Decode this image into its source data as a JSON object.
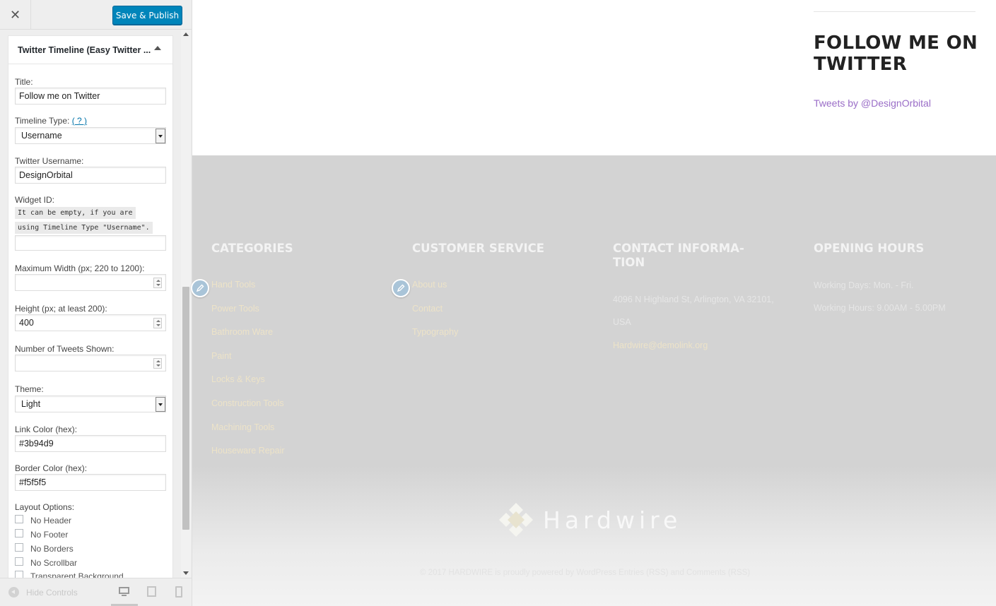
{
  "header": {
    "close_glyph": "✕",
    "save_label": "Save & Publish"
  },
  "widget": {
    "title": "Twitter Timeline (Easy Twitter ...",
    "fields": {
      "title_label": "Title:",
      "title_value": "Follow me on Twitter",
      "timeline_type_label": "Timeline Type:",
      "timeline_type_help": "( ? )",
      "timeline_type_value": "Username",
      "username_label": "Twitter Username:",
      "username_value": "DesignOrbital",
      "widget_id_label": "Widget ID:",
      "widget_id_hint_1": "It can be empty, if you are",
      "widget_id_hint_2": "using Timeline Type \"Username\".",
      "widget_id_value": "",
      "max_width_label": "Maximum Width (px; 220 to 1200):",
      "max_width_value": "",
      "height_label": "Height (px; at least 200):",
      "height_value": "400",
      "tweets_shown_label": "Number of Tweets Shown:",
      "tweets_shown_value": "",
      "theme_label": "Theme:",
      "theme_value": "Light",
      "link_color_label": "Link Color (hex):",
      "link_color_value": "#3b94d9",
      "border_color_label": "Border Color (hex):",
      "border_color_value": "#f5f5f5",
      "layout_label": "Layout Options:"
    },
    "layout_options": [
      "No Header",
      "No Footer",
      "No Borders",
      "No Scrollbar",
      "Transparent Background"
    ]
  },
  "sidebar_footer": {
    "hide_controls": "Hide Controls",
    "devices": [
      "desktop-icon",
      "tablet-icon",
      "mobile-icon"
    ]
  },
  "preview": {
    "twitter_widget": {
      "heading": "FOLLOW ME ON TWITTER",
      "link": "Tweets by @DesignOrbital",
      "link_color": "#9a6dc7"
    },
    "footer": {
      "categories": {
        "heading": "CATEGORIES",
        "items": [
          "Hand Tools",
          "Power Tools",
          "Bathroom Ware",
          "Paint",
          "Locks & Keys",
          "Construction Tools",
          "Machining Tools",
          "Houseware Repair"
        ]
      },
      "customer_service": {
        "heading": "CUSTOMER SERVICE",
        "items": [
          "About us",
          "Contact",
          "Typography"
        ]
      },
      "contact": {
        "heading_1": "CONTACT INFORMA-",
        "heading_2": "TION",
        "address_1": "4096 N Highland St, Arlington, VA 32101,",
        "address_2": "USA",
        "email": "Hardwire@demolink.org"
      },
      "hours": {
        "heading": "OPENING HOURS",
        "days": "Working Days: Mon. - Fri.",
        "hours": "Working Hours: 9.00AM - 5.00PM"
      },
      "logo_text": "Hardwire",
      "copyright": "© 2017 HARDWIRE is proudly powered by WordPress Entries (RSS) and Comments (RSS)"
    }
  },
  "colors": {
    "accent": "#0085ba",
    "footer_bg": "#d3d3d3",
    "link_hex": "#3b94d9"
  }
}
